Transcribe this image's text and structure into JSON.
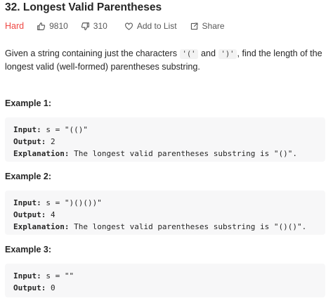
{
  "problem": {
    "title": "32. Longest Valid Parentheses",
    "difficulty": "Hard",
    "likes": "9810",
    "dislikes": "310",
    "add_to_list": "Add to List",
    "share": "Share",
    "colors": {
      "difficulty": "#ef4743",
      "text": "#262626",
      "code_bg": "#f7f7f8"
    }
  },
  "description": {
    "part1": "Given a string containing just the characters ",
    "code1": "'('",
    "and": " and ",
    "code2": "')'",
    "part2": ", find the length of the longest valid (well-formed) parentheses substring."
  },
  "examples": [
    {
      "title": "Example 1:",
      "input_label": "Input:",
      "input_value": " s = \"(()\"",
      "output_label": "Output:",
      "output_value": " 2",
      "explanation_label": "Explanation:",
      "explanation_value": " The longest valid parentheses substring is \"()\"."
    },
    {
      "title": "Example 2:",
      "input_label": "Input:",
      "input_value": " s = \")()())\"",
      "output_label": "Output:",
      "output_value": " 4",
      "explanation_label": "Explanation:",
      "explanation_value": " The longest valid parentheses substring is \"()()\"."
    },
    {
      "title": "Example 3:",
      "input_label": "Input:",
      "input_value": " s = \"\"",
      "output_label": "Output:",
      "output_value": " 0"
    }
  ],
  "icons": {
    "like": "thumbs-up-icon",
    "dislike": "thumbs-down-icon",
    "add_to_list": "heart-icon",
    "share": "share-icon"
  }
}
